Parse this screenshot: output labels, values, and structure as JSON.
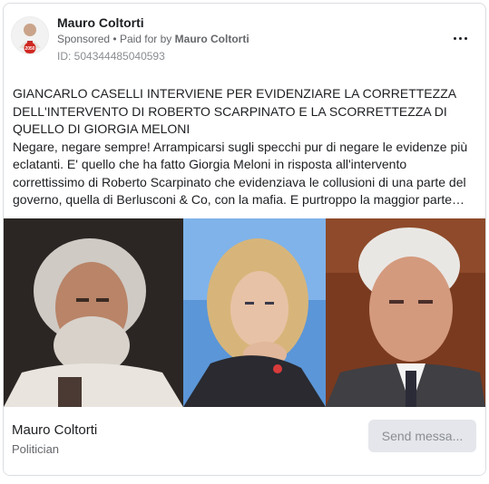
{
  "advertiser": {
    "name": "Mauro Coltorti",
    "avatar_badge": "2050"
  },
  "sponsorship": {
    "label": "Sponsored",
    "separator": "•",
    "paid_for_prefix": "Paid for by",
    "paid_for_name": "Mauro Coltorti"
  },
  "ad_id": "ID: 504344485040593",
  "menu": {
    "icon": "more-options-icon"
  },
  "post": {
    "title": "GIANCARLO CASELLI INTERVIENE PER EVIDENZIARE LA CORRETTEZZA DELL'INTERVENTO DI ROBERTO SCARPINATO E LA SCORRETTEZZA DI QUELLO DI GIORGIA MELONI",
    "body": "Negare, negare sempre! Arrampicarsi sugli specchi pur di negare le evidenze più eclatanti. E' quello che ha fatto Giorgia Meloni in risposta all'intervento correttissimo di Roberto Scarpinato che evidenziava le collusioni di una parte del governo, quella di Berlusconi & Co, con la mafia. E purtroppo la maggior parte de..."
  },
  "footer": {
    "page_name": "Mauro Coltorti",
    "category": "Politician",
    "cta_label": "Send messa..."
  },
  "colors": {
    "border": "#dadde1",
    "secondary_text": "#65676b",
    "button_bg": "#e4e6eb",
    "button_text": "#8a8d91"
  }
}
